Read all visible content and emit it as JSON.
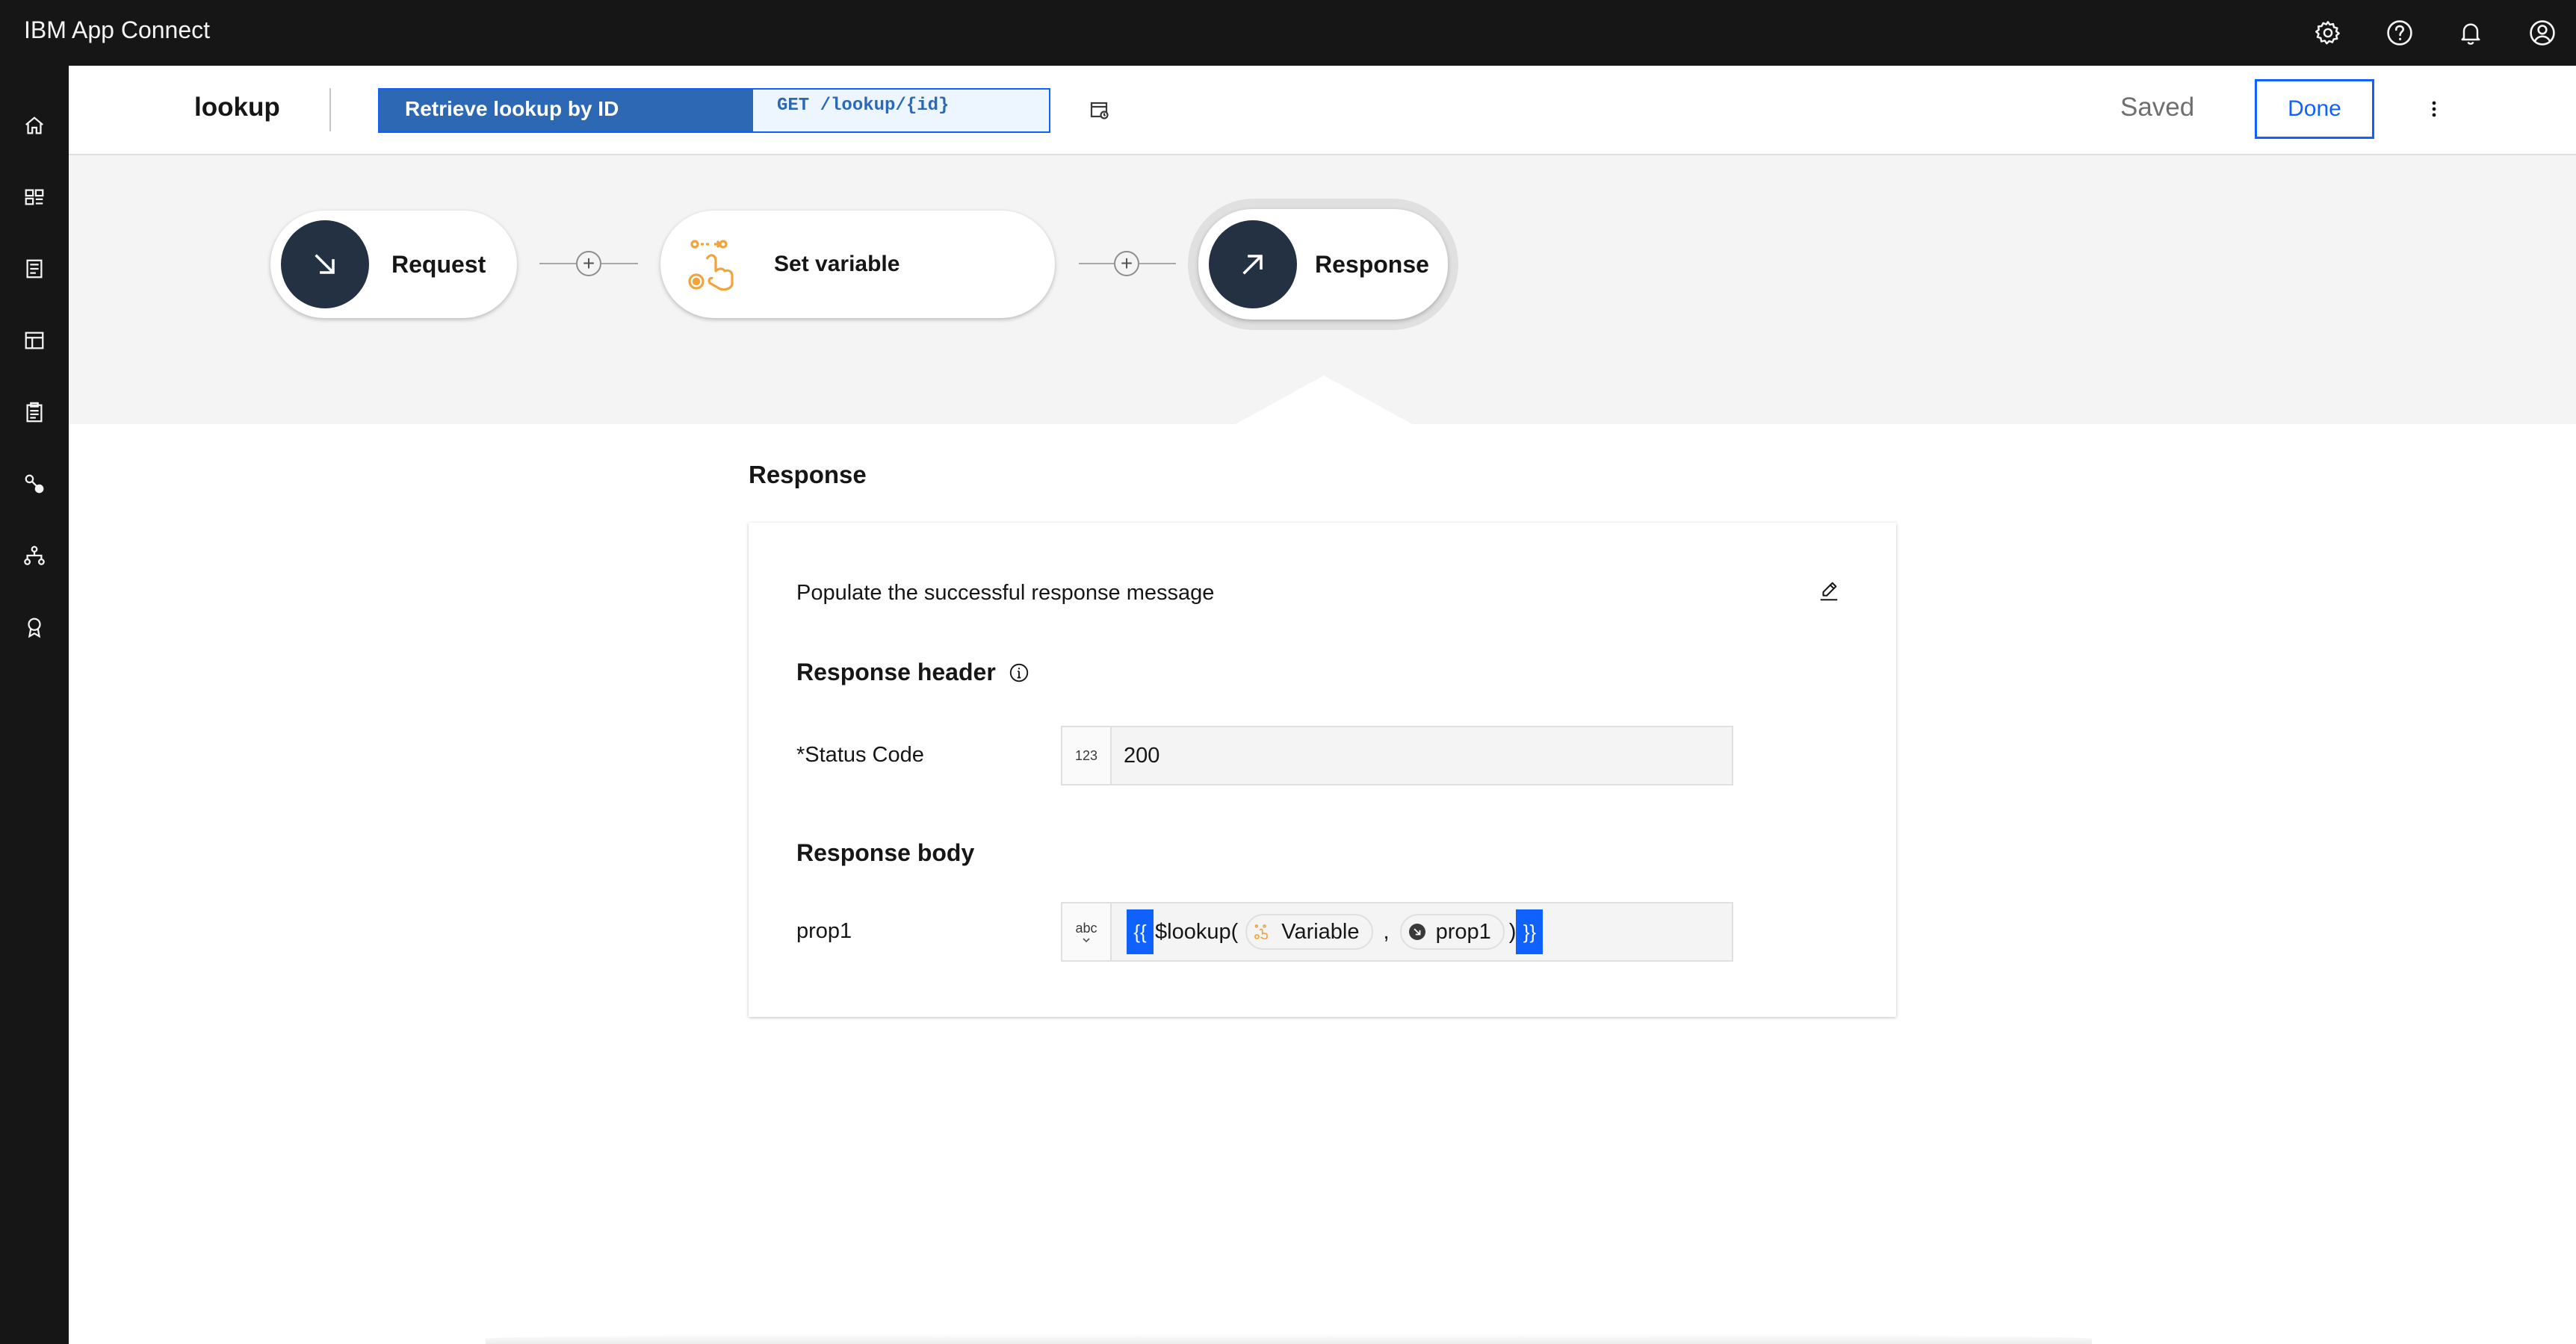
{
  "app": {
    "title": "IBM App Connect"
  },
  "topbar": {
    "icons": [
      "settings-icon",
      "help-icon",
      "notification-icon",
      "user-icon"
    ]
  },
  "sidenav": {
    "icons": [
      "home-icon",
      "dashboard-icon",
      "catalog-icon",
      "templates-icon",
      "clipboard-icon",
      "connections-icon",
      "hierarchy-icon",
      "badge-icon"
    ]
  },
  "flow": {
    "name": "lookup",
    "operation": {
      "name": "Retrieve lookup by ID",
      "path": "GET /lookup/{id}"
    },
    "status": "Saved",
    "done_label": "Done"
  },
  "nodes": [
    {
      "label": "Request",
      "icon": "arrow-down-right-icon"
    },
    {
      "label": "Set variable",
      "icon": "set-variable-icon"
    },
    {
      "label": "Response",
      "icon": "arrow-up-right-icon",
      "selected": true
    }
  ],
  "panel": {
    "title": "Response",
    "description": "Populate the successful response message",
    "header_title": "Response header",
    "status_code": {
      "label": "*Status Code",
      "type": "123",
      "value": "200"
    },
    "body_title": "Response body",
    "prop1": {
      "label": "prop1",
      "type": "abc",
      "expression": {
        "open": "{{",
        "function": "$lookup(",
        "token1": "Variable",
        "separator": ",",
        "token2": "prop1",
        "paren": ")",
        "close": "}}"
      }
    }
  },
  "colors": {
    "accent": "#0f62fe",
    "topbar": "#161616",
    "operation": "#2c68b3",
    "node_circle": "#233142",
    "set_variable": "#f1a33c"
  }
}
